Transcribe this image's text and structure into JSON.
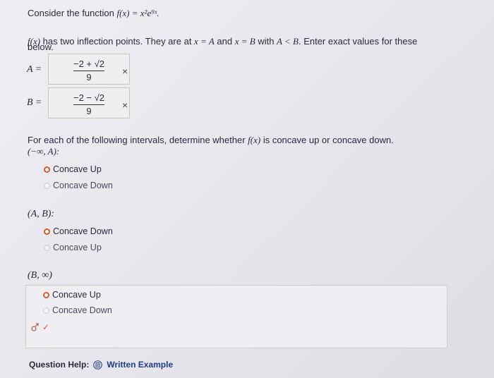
{
  "question": {
    "intro_prefix": "Consider the function ",
    "function_expr": "f(x) = x²e⁹ˣ.",
    "line2_fx": "f(x)",
    "line2_text": " has two inflection points. They are at ",
    "line2_xA": "x = A",
    "line2_and": " and ",
    "line2_xB": "x = B",
    "line2_with": " with ",
    "line2_AltB": "A < B",
    "line2_end": ". Enter exact values for these",
    "line3": "below."
  },
  "answers": {
    "A_label": "A =",
    "A_num": "−2 + √2",
    "A_den": "9",
    "B_label": "B =",
    "B_num": "−2 − √2",
    "B_den": "9",
    "incorrect_mark": "×"
  },
  "concavity": {
    "prompt_prefix": "For each of the following intervals, determine whether ",
    "prompt_fx": "f(x)",
    "prompt_suffix": " is concave up or concave down.",
    "intervals": [
      {
        "label": "(−∞, A):",
        "options": [
          {
            "label": "Concave Up",
            "selected": true
          },
          {
            "label": "Concave Down",
            "selected": false
          }
        ]
      },
      {
        "label": "(A, B):",
        "options": [
          {
            "label": "Concave Down",
            "selected": true
          },
          {
            "label": "Concave Up",
            "selected": false
          }
        ]
      },
      {
        "label": "(B, ∞)",
        "options": [
          {
            "label": "Concave Up",
            "selected": true
          },
          {
            "label": "Concave Down",
            "selected": false
          }
        ]
      }
    ]
  },
  "feedback": {
    "check": "✓"
  },
  "help": {
    "label": "Question Help:",
    "link": "Written Example"
  },
  "colors": {
    "selected_radio": "#d65a2b",
    "link": "#1f3c8a",
    "check": "#d65a2b"
  }
}
